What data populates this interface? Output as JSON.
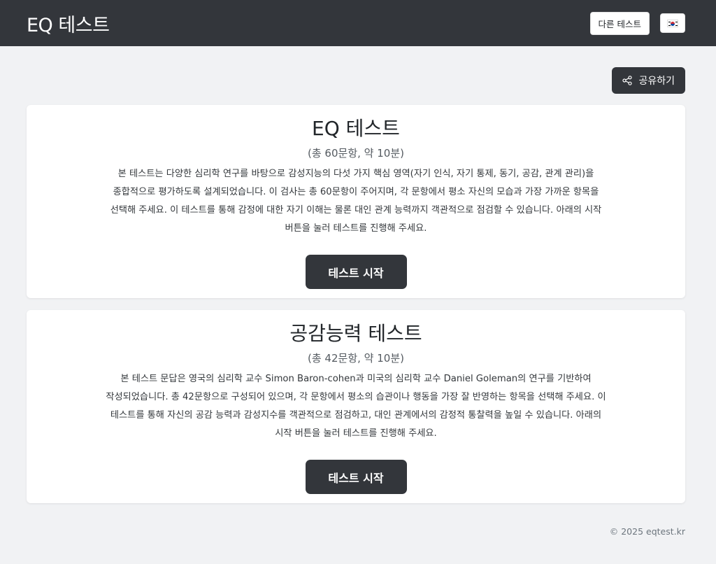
{
  "navbar": {
    "brand": "EQ 테스트",
    "other_tests_label": "다른 테스트",
    "language_icon": "korea-flag-icon"
  },
  "share": {
    "label": "공유하기",
    "icon": "share-icon"
  },
  "tests": [
    {
      "title": "EQ 테스트",
      "subtitle": "(총 60문항, 약 10분)",
      "description": "본 테스트는 다양한 심리학 연구를 바탕으로 감성지능의 다섯 가지 핵심 영역(자기 인식, 자기 통제, 동기, 공감, 관계 관리)을 종합적으로 평가하도록 설계되었습니다. 이 검사는 총 60문항이 주어지며, 각 문항에서 평소 자신의 모습과 가장 가까운 항목을 선택해 주세요. 이 테스트를 통해 감정에 대한 자기 이해는 물론 대인 관계 능력까지 객관적으로 점검할 수 있습니다. 아래의 시작 버튼을 눌러 테스트를 진행해 주세요.",
      "start_label": "테스트 시작"
    },
    {
      "title": "공감능력 테스트",
      "subtitle": "(총 42문항, 약 10분)",
      "description": "본 테스트 문답은 영국의 심리학 교수 Simon Baron-cohen과 미국의 심리학 교수 Daniel Goleman의 연구를 기반하여 작성되었습니다. 총 42문항으로 구성되어 있으며, 각 문항에서 평소의 습관이나 행동을 가장 잘 반영하는 항목을 선택해 주세요. 이 테스트를 통해 자신의 공감 능력과 감성지수를 객관적으로 점검하고, 대인 관계에서의 감정적 통찰력을 높일 수 있습니다. 아래의 시작 버튼을 눌러 테스트를 진행해 주세요.",
      "start_label": "테스트 시작"
    }
  ],
  "footer": {
    "copyright": "© 2025 eqtest.kr"
  },
  "colors": {
    "navbar_bg": "#33363b",
    "page_bg": "#f1f2f4",
    "button_dark": "#33363b"
  }
}
